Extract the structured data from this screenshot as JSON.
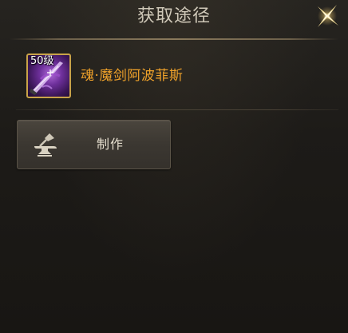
{
  "dialog": {
    "title": "获取途径"
  },
  "item": {
    "level_badge": "50级",
    "name": "魂·魔剑阿波菲斯",
    "frame_color": "#c9a349",
    "name_color": "#f0a22a",
    "icon": "purple-sword-icon"
  },
  "sources": [
    {
      "label": "制作",
      "icon": "anvil-icon"
    }
  ],
  "close": {
    "icon": "close-x-icon"
  }
}
